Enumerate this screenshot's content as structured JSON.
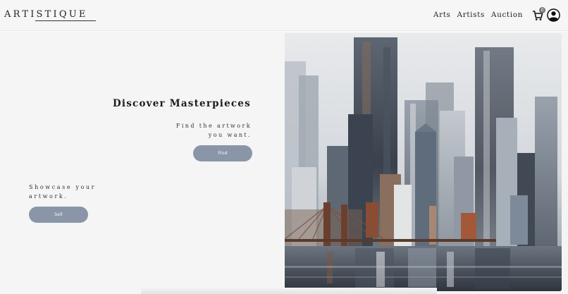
{
  "header": {
    "logo": "ARTISTIQUE",
    "nav": [
      "Arts",
      "Artists",
      "Auction"
    ],
    "cart_count": "0"
  },
  "hero": {
    "title": "Discover Masterpieces",
    "find_text": "Find the artwork you want.",
    "find_button": "Find",
    "showcase_text": "Showcase your artwork.",
    "sell_button": "Sell"
  },
  "colors": {
    "button": "#8a96a8",
    "header_bg": "#f6f6f6",
    "page_bg": "#f4f4f4"
  },
  "icons": [
    "cart-icon",
    "user-account-icon"
  ]
}
